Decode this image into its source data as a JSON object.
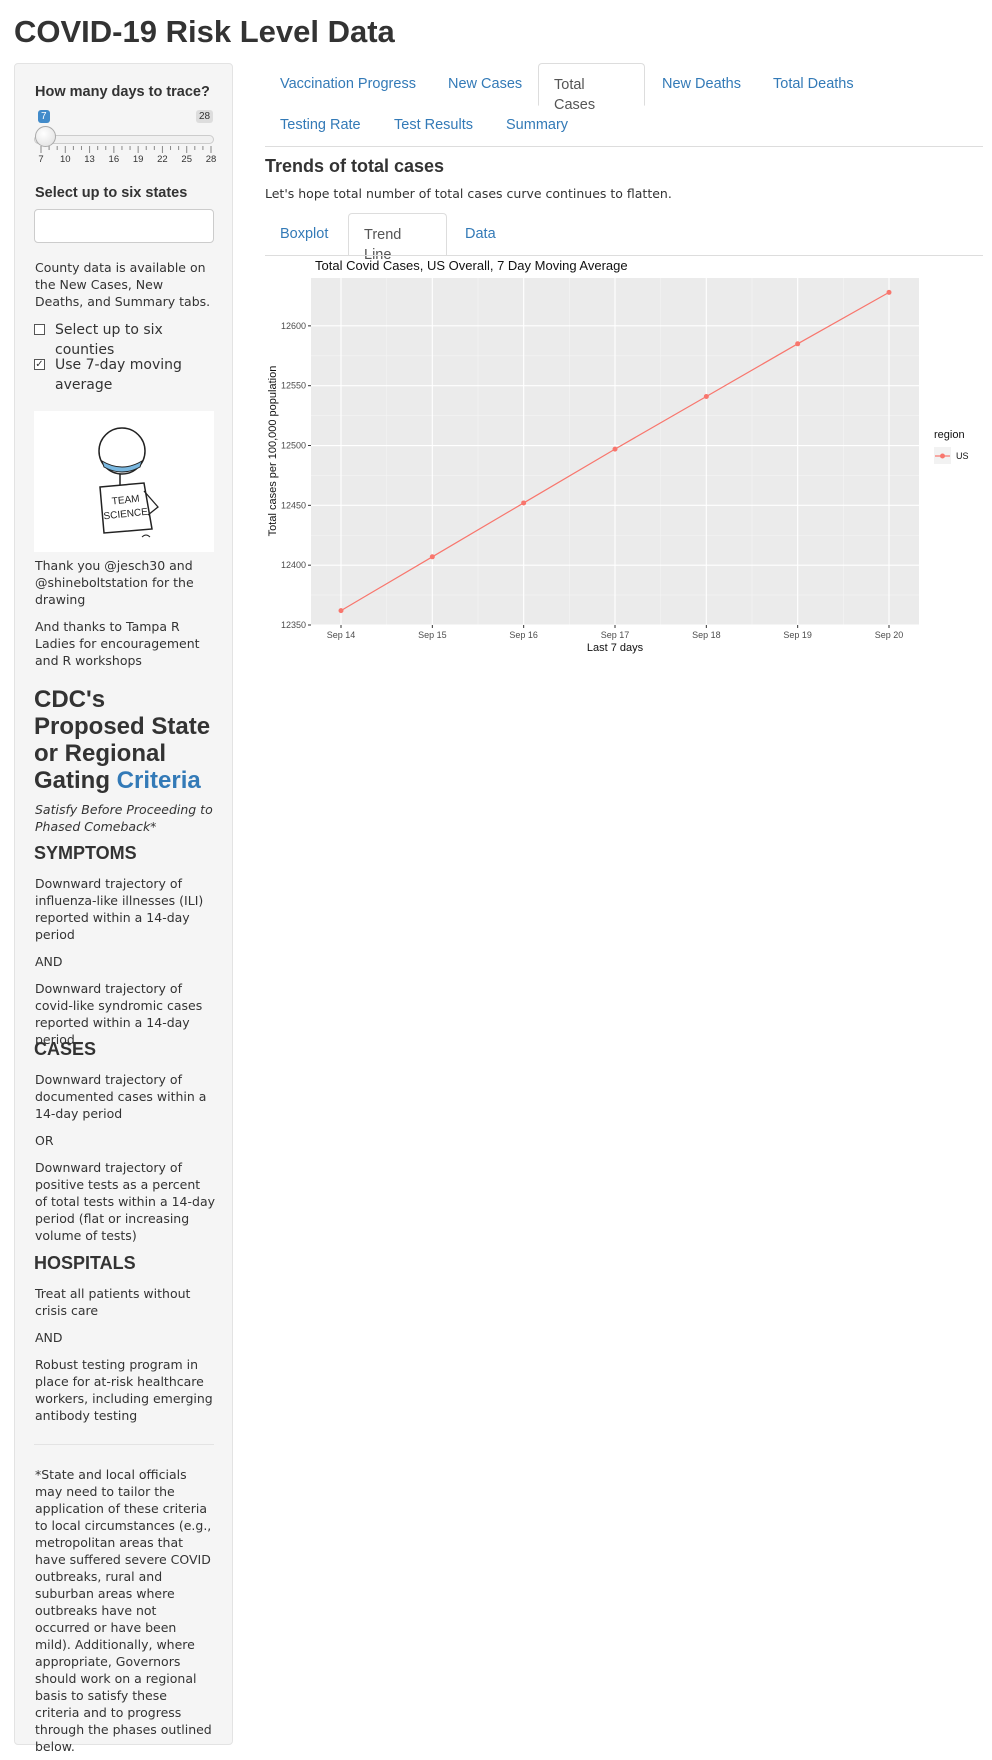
{
  "app": {
    "title": "COVID-19 Risk Level Data"
  },
  "sidebar": {
    "days_label": "How many days to trace?",
    "slider": {
      "min_badge": "7",
      "max_badge": "28",
      "value": 7,
      "min": 7,
      "max": 28,
      "tick_labels": [
        "7",
        "10",
        "13",
        "16",
        "19",
        "22",
        "25",
        "28"
      ]
    },
    "states_label": "Select up to six states",
    "states_input_value": "",
    "county_note": "County data is available on the New Cases, New Deaths, and Summary tabs.",
    "counties_checkbox": {
      "label": "Select up to six counties",
      "checked": false
    },
    "moving_avg_checkbox": {
      "label": "Use 7-day moving average",
      "checked": true
    },
    "drawing": {
      "sign_text_1": "TEAM",
      "sign_text_2": "SCIENCE",
      "icon": "team-science-drawing"
    },
    "thanks_1": "Thank you @jesch30 and @shineboltstation for the drawing",
    "thanks_2": "And thanks to Tampa R Ladies for encouragement and R workshops",
    "cdc_heading": "CDC's Proposed State or Regional Gating",
    "cdc_link": "Criteria",
    "cdc_sub": "Satisfy Before Proceeding to Phased Comeback*",
    "symptoms_heading": "SYMPTOMS",
    "symptoms_1": "Downward trajectory of influenza-like illnesses (ILI) reported within a 14-day period",
    "and_1": "AND",
    "symptoms_2": "Downward trajectory of covid-like syndromic cases reported within a 14-day period",
    "cases_heading": "CASES",
    "cases_1": "Downward trajectory of documented cases within a 14-day period",
    "or_1": "OR",
    "cases_2": "Downward trajectory of positive tests as a percent of total tests within a 14-day period (flat or increasing volume of tests)",
    "hospitals_heading": "HOSPITALS",
    "hospitals_1": "Treat all patients without crisis care",
    "and_2": "AND",
    "hospitals_2": "Robust testing program in place for at-risk healthcare workers, including emerging antibody testing",
    "footnote": "*State and local officials may need to tailor the application of these criteria to local circumstances (e.g., metropolitan areas that have suffered severe COVID outbreaks, rural and suburban areas where outbreaks have not occurred or have been mild). Additionally, where appropriate, Governors should work on a regional basis to satisfy these criteria and to progress through the phases outlined below."
  },
  "main_tabs": [
    "Vaccination Progress",
    "New Cases",
    "Total Cases",
    "New Deaths",
    "Total Deaths",
    "Testing Rate",
    "Test Results",
    "Summary"
  ],
  "active_main_tab": "Total Cases",
  "section": {
    "title": "Trends of total cases",
    "description": "Let's hope total number of total cases curve continues to flatten."
  },
  "sub_tabs": [
    "Boxplot",
    "Trend Line",
    "Data"
  ],
  "active_sub_tab": "Trend Line",
  "colors": {
    "accent": "#337ab7",
    "series": "#f8766d",
    "panel": "#ebebeb"
  },
  "chart_data": {
    "type": "line",
    "title": "Total Covid Cases, US Overall, 7 Day Moving Average",
    "xlabel": "Last 7 days",
    "ylabel": "Total cases per 100,000 population",
    "categories": [
      "Sep 14",
      "Sep 15",
      "Sep 16",
      "Sep 17",
      "Sep 18",
      "Sep 19",
      "Sep 20"
    ],
    "series": [
      {
        "name": "US",
        "values": [
          12362,
          12407,
          12452,
          12497,
          12541,
          12585,
          12628
        ]
      }
    ],
    "ylim": [
      12350,
      12640
    ],
    "yticks": [
      12350,
      12400,
      12450,
      12500,
      12550,
      12600
    ],
    "legend_title": "region",
    "legend_position": "right",
    "grid": true
  }
}
